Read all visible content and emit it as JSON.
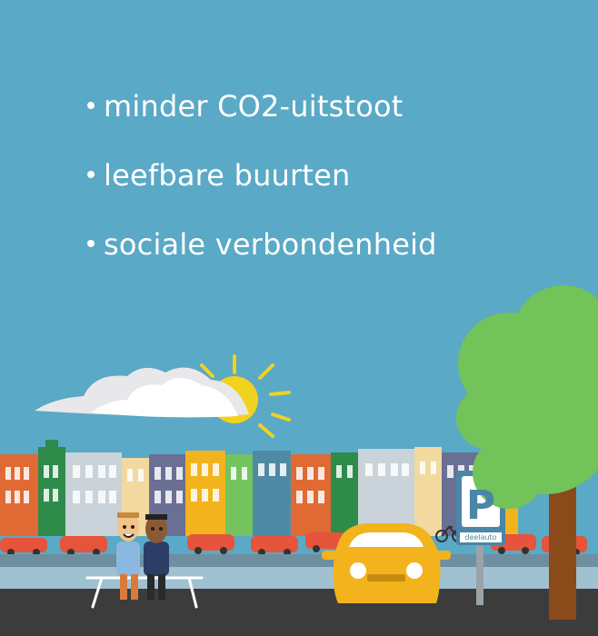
{
  "bullets": [
    {
      "text": "minder CO2-uitstoot"
    },
    {
      "text": "leefbare buurten"
    },
    {
      "text": "sociale verbondenheid"
    }
  ],
  "parking_sign": {
    "letter": "P",
    "label": "deelauto"
  },
  "colors": {
    "sky": "#5aa9c6",
    "text": "#ffffff",
    "sun": "#f1d21e",
    "tree": "#72c45a",
    "trunk": "#8b4a1a",
    "car_yellow": "#f2b31d",
    "car_red": "#e5543b",
    "road": "#3c3c3c",
    "sign": "#4a86a8"
  },
  "icons": [
    "sun-icon",
    "cloud-icon",
    "tree-icon",
    "parking-sign-icon",
    "car-icon",
    "bench-icon",
    "bicycle-icon"
  ]
}
